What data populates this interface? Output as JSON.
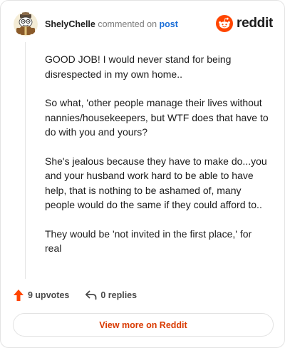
{
  "header": {
    "username": "ShelyChelle",
    "action_text": "commented on",
    "post_link": "post",
    "avatar_icon": "snoo-avatar-icon"
  },
  "brand": {
    "wordmark": "reddit",
    "logo_icon": "reddit-snoo-icon",
    "accent_color": "#ff4500"
  },
  "comment": {
    "paragraphs": [
      "GOOD JOB! I would never stand for being disrespected in my own home..",
      "So what, 'other people manage their lives without nannies/housekeepers, but WTF does that have to do with you and yours?",
      "She's jealous because they have to make do...you and your husband work hard to be able to have help, that is nothing to be ashamed of, many people would do the same if they could afford to..",
      "They would be 'not invited in the first place,' for real"
    ]
  },
  "actions": {
    "upvotes": "9 upvotes",
    "upvote_icon": "upvote-arrow-icon",
    "replies": "0 replies",
    "reply_icon": "reply-arrow-icon"
  },
  "cta": {
    "label": "View more on Reddit",
    "color": "#d93a00"
  }
}
